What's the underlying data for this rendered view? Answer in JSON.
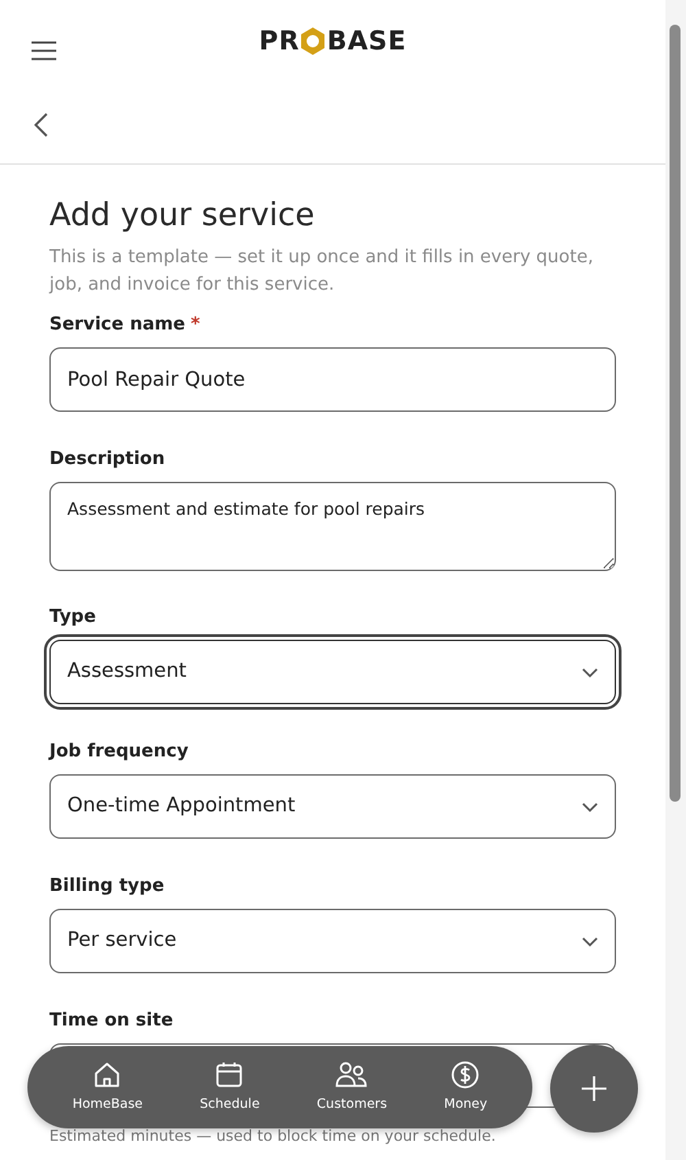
{
  "header": {
    "logo_left": "PR",
    "logo_right": "BASE"
  },
  "page": {
    "title": "Add your service",
    "subtitle": "This is a template — set it up once and it fills in every quote, job, and invoice for this service."
  },
  "fields": [
    {
      "kind": "input",
      "label": "Service name",
      "required_mark": "*",
      "value": "Pool Repair Quote",
      "focused": false
    },
    {
      "kind": "textarea",
      "label": "Description",
      "value": "Assessment and estimate for pool repairs",
      "focused": false
    },
    {
      "kind": "select",
      "label": "Type",
      "value": "Assessment",
      "focused": true
    },
    {
      "kind": "select",
      "label": "Job frequency",
      "value": "One-time Appointment",
      "focused": false
    },
    {
      "kind": "select",
      "label": "Billing type",
      "value": "Per service",
      "focused": false
    },
    {
      "kind": "input",
      "label": "Time on site",
      "help": "Estimated minutes — used to block time on your schedule."
    }
  ],
  "bottom_nav": [
    {
      "label": "HomeBase"
    },
    {
      "label": "Schedule"
    },
    {
      "label": "Customers"
    },
    {
      "label": "Money"
    }
  ]
}
